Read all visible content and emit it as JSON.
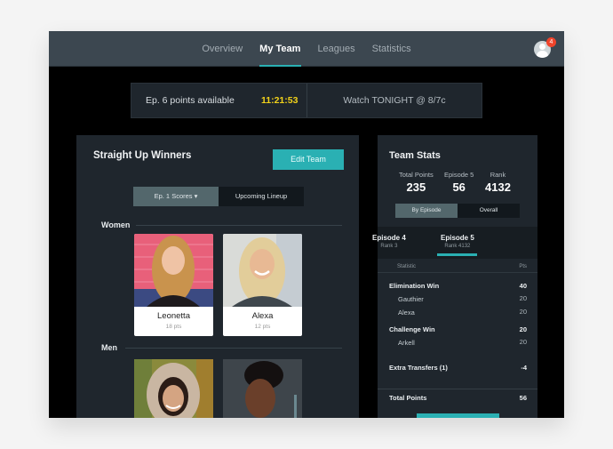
{
  "nav": {
    "tabs": [
      {
        "label": "Overview",
        "active": false
      },
      {
        "label": "My Team",
        "active": true
      },
      {
        "label": "Leagues",
        "active": false
      },
      {
        "label": "Statistics",
        "active": false
      }
    ],
    "notification_count": "4",
    "accent_color": "#2ab0b3"
  },
  "ticker": {
    "label": "Ep. 6 points available",
    "timer": "11:21:53",
    "watch": "Watch TONIGHT @ 8/7c"
  },
  "team": {
    "title": "Straight Up Winners",
    "edit_label": "Edit Team",
    "tabs": [
      {
        "label": "Ep. 1 Scores ▾",
        "active": true
      },
      {
        "label": "Upcoming Lineup",
        "active": false
      }
    ],
    "women_label": "Women",
    "men_label": "Men",
    "women": [
      {
        "name": "Leonetta",
        "pts": "18 pts"
      },
      {
        "name": "Alexa",
        "pts": "12 pts"
      }
    ]
  },
  "stats": {
    "title": "Team Stats",
    "kpis": [
      {
        "label": "Total Points",
        "value": "235"
      },
      {
        "label": "Episode 5",
        "value": "56"
      },
      {
        "label": "Rank",
        "value": "4132"
      }
    ],
    "tabs": [
      {
        "label": "By Episode",
        "active": true
      },
      {
        "label": "Overall",
        "active": false
      }
    ],
    "episodes": [
      {
        "name": "Episode 4",
        "rank": "Rank 3"
      },
      {
        "name": "Episode 5",
        "rank": "Rank 4132",
        "active": true
      }
    ],
    "col_statistic": "Statistic",
    "col_pts": "Pts",
    "rows": [
      {
        "label": "Elimination Win",
        "pts": "40",
        "type": "bold"
      },
      {
        "label": "Gauthier",
        "pts": "20",
        "type": "sub"
      },
      {
        "label": "Alexa",
        "pts": "20",
        "type": "sub"
      },
      {
        "label": "Challenge Win",
        "pts": "20",
        "type": "bold"
      },
      {
        "label": "Arkell",
        "pts": "20",
        "type": "sub"
      },
      {
        "label": "Extra Transfers (1)",
        "pts": "-4",
        "type": "bold"
      }
    ],
    "total_label": "Total Points",
    "total_value": "56"
  }
}
